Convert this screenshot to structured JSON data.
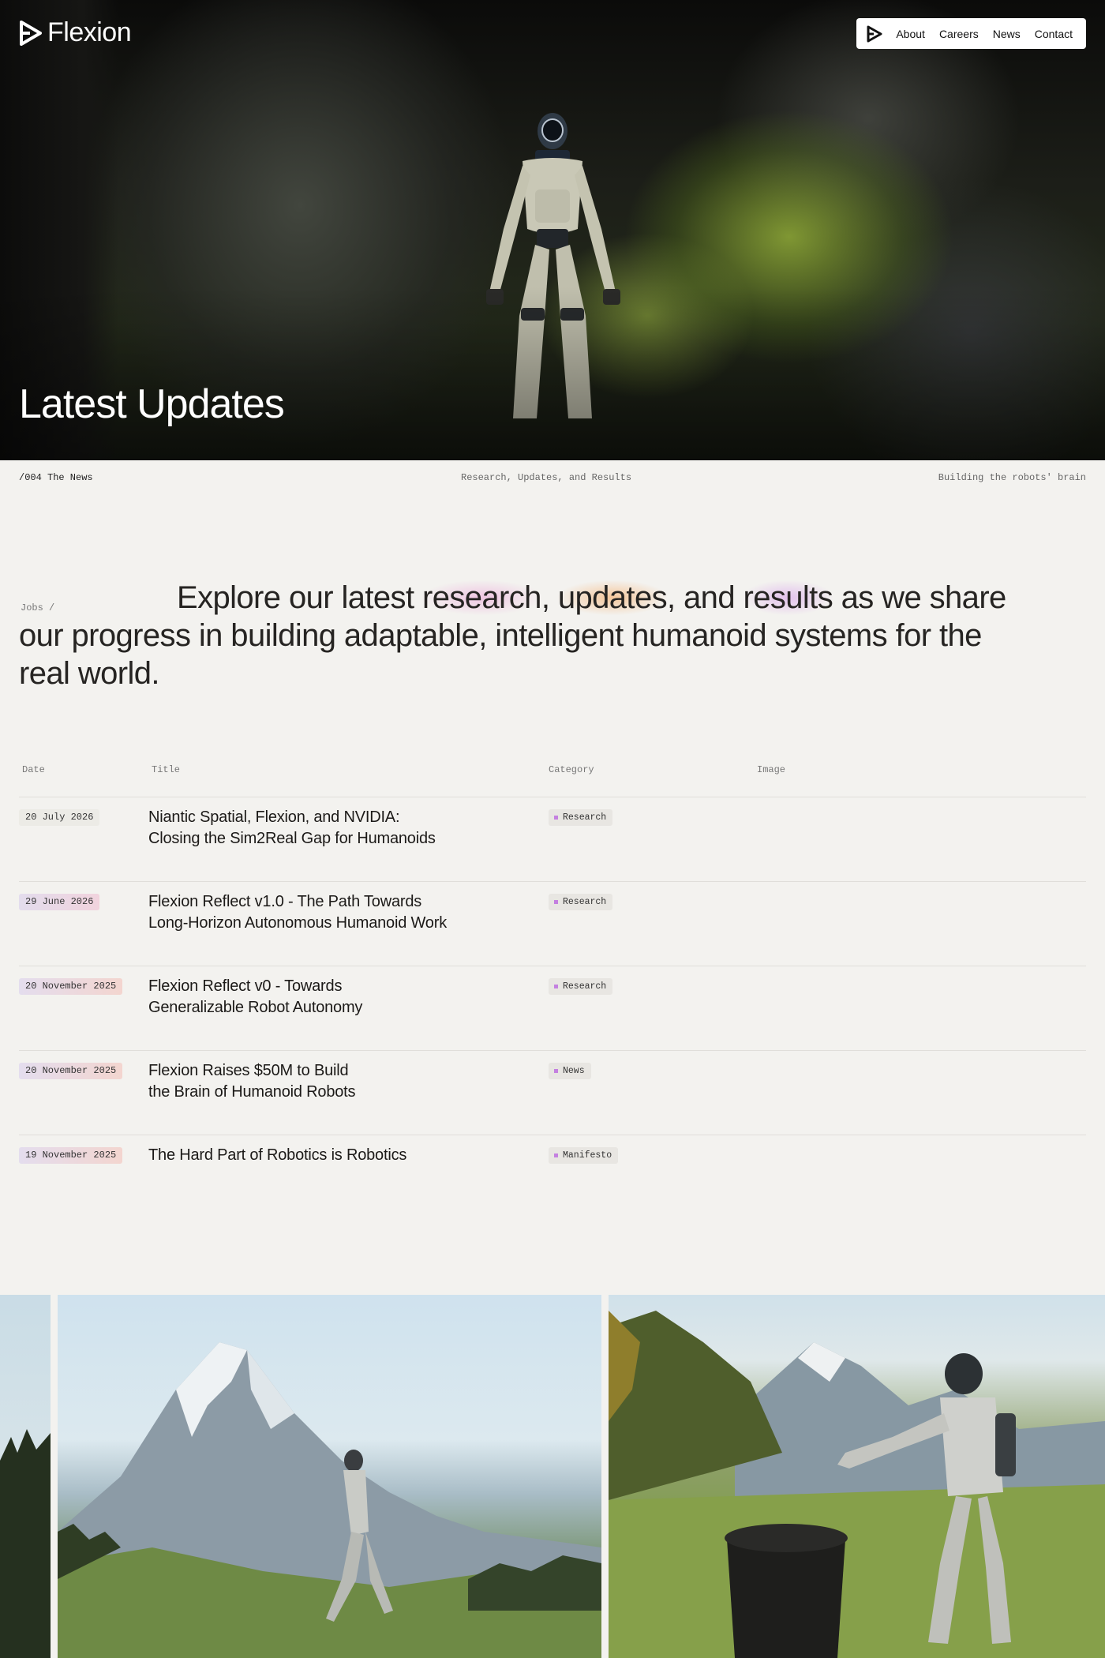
{
  "brand": {
    "name": "Flexion"
  },
  "nav": {
    "items": [
      "About",
      "Careers",
      "News",
      "Contact"
    ]
  },
  "hero": {
    "title": "Latest Updates"
  },
  "meta": {
    "section": "/004 The News",
    "tagline": "Research, Updates, and Results",
    "motto": "Building the robots' brain"
  },
  "intro": {
    "breadcrumb": "Jobs /",
    "text_before": "Explore our latest ",
    "word_research": "research",
    "comma1": ", ",
    "word_updates": "updates",
    "and": ", and ",
    "word_results": "results",
    "text_after": " as we share our progress in building adaptable, intelligent humanoid systems for the real world."
  },
  "table": {
    "headers": {
      "date": "Date",
      "title": "Title",
      "category": "Category",
      "image": "Image"
    },
    "rows": [
      {
        "date": "20 July 2026",
        "title": "Niantic Spatial, Flexion, and NVIDIA:\nClosing the Sim2Real Gap for Humanoids",
        "category": "Research"
      },
      {
        "date": "29 June 2026",
        "title": "Flexion Reflect v1.0 - The Path Towards\nLong-Horizon Autonomous Humanoid Work",
        "category": "Research"
      },
      {
        "date": "20 November 2025",
        "title": "Flexion Reflect v0 - Towards\nGeneralizable Robot Autonomy",
        "category": "Research"
      },
      {
        "date": "20 November 2025",
        "title": "Flexion Raises $50M to Build\nthe Brain of Humanoid Robots",
        "category": "News"
      },
      {
        "date": "19 November 2025",
        "title": "The Hard Part of Robotics is Robotics",
        "category": "Manifesto"
      }
    ]
  },
  "colors": {
    "background": "#f3f2ef",
    "badge_gradient_start": "#e6def0",
    "badge_gradient_end": "#f3d6cf",
    "category_dot": "#c480e0"
  }
}
